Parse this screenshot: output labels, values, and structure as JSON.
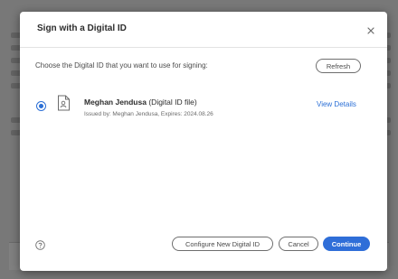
{
  "dialog": {
    "title": "Sign with a Digital ID",
    "prompt": "Choose the Digital ID that you want to use for signing:",
    "refresh_label": "Refresh",
    "digital_id": {
      "name": "Meghan Jendusa",
      "type": "(Digital ID file)",
      "issued": "Issued by: Meghan Jendusa, Expires: 2024.08.26",
      "selected": true
    },
    "view_details_label": "View Details",
    "configure_label": "Configure New Digital ID",
    "cancel_label": "Cancel",
    "continue_label": "Continue"
  },
  "colors": {
    "accent": "#2f6ed8",
    "text": "#2c2c2c"
  },
  "icons": [
    "close-icon",
    "digital-id-file-icon",
    "help-icon"
  ]
}
